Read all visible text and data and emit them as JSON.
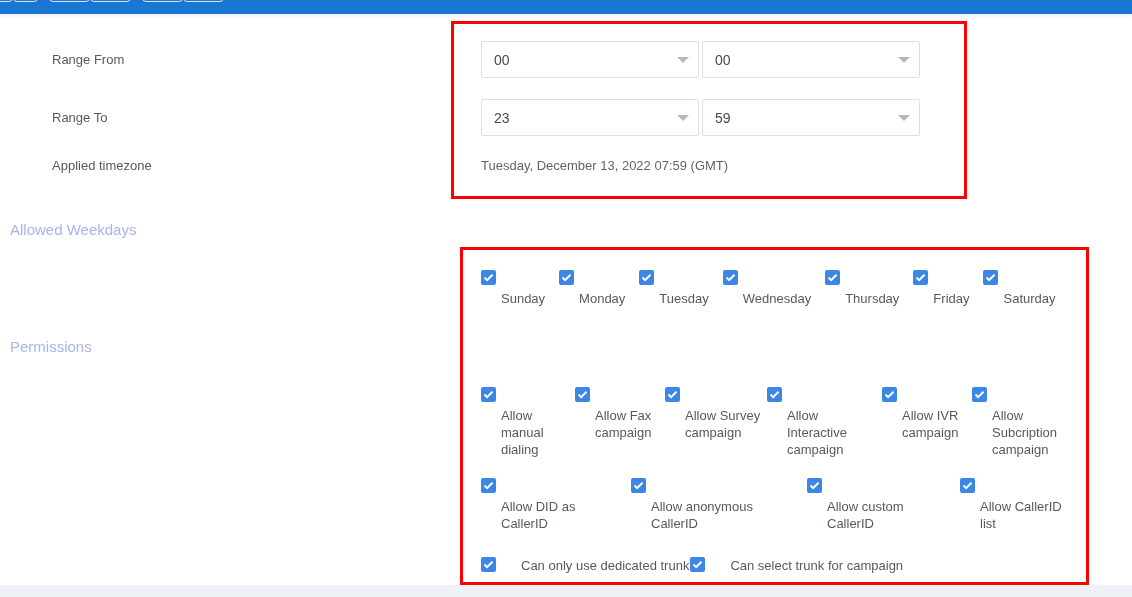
{
  "time_range": [
    {
      "label": "Range From",
      "hour": "00",
      "minute": "00"
    },
    {
      "label": "Range To",
      "hour": "23",
      "minute": "59"
    }
  ],
  "timezone": {
    "label": "Applied timezone",
    "value": "Tuesday, December 13, 2022 07:59 (GMT)"
  },
  "weekdays": {
    "title": "Allowed Weekdays",
    "items": [
      {
        "label": "Sunday",
        "checked": true
      },
      {
        "label": "Monday",
        "checked": true
      },
      {
        "label": "Tuesday",
        "checked": true
      },
      {
        "label": "Wednesday",
        "checked": true
      },
      {
        "label": "Thursday",
        "checked": true
      },
      {
        "label": "Friday",
        "checked": true
      },
      {
        "label": "Saturday",
        "checked": true
      }
    ]
  },
  "permissions": {
    "title": "Permissions",
    "groups": [
      {
        "items": [
          {
            "label": "Allow manual dialing",
            "checked": true
          },
          {
            "label": "Allow Fax campaign",
            "checked": true
          },
          {
            "label": "Allow Survey campaign",
            "checked": true
          },
          {
            "label": "Allow Interactive campaign",
            "checked": true
          },
          {
            "label": "Allow IVR campaign",
            "checked": true
          },
          {
            "label": "Allow Subcription campaign",
            "checked": true
          }
        ]
      },
      {
        "items": [
          {
            "label": "Allow DID as CallerID",
            "checked": true
          },
          {
            "label": "Allow anonymous CallerID",
            "checked": true
          },
          {
            "label": "Allow custom CallerID",
            "checked": true
          },
          {
            "label": "Allow CallerID list",
            "checked": true
          }
        ]
      },
      {
        "items": [
          {
            "label": "Can only use dedicated trunk",
            "checked": true
          },
          {
            "label": "Can select trunk for campaign",
            "checked": true
          }
        ]
      }
    ]
  }
}
